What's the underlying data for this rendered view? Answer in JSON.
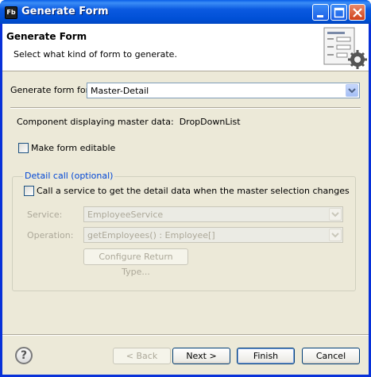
{
  "window": {
    "title": "Generate Form",
    "app_icon": "Fb"
  },
  "banner": {
    "title": "Generate Form",
    "subtitle": "Select what kind of form to generate.",
    "image": "form-gear-icon"
  },
  "form": {
    "generate_for_label": "Generate form for:",
    "generate_for_value": "Master-Detail",
    "master_label": "Component displaying master data:",
    "master_value": "DropDownList",
    "editable_label": "Make form editable",
    "editable_checked": false
  },
  "detail_call": {
    "legend": "Detail call (optional)",
    "service_checkbox_label": "Call a service to get the detail data when the master selection changes",
    "service_checkbox_checked": false,
    "service_label": "Service:",
    "service_value": "EmployeeService",
    "operation_label": "Operation:",
    "operation_value": "getEmployees() : Employee[]",
    "configure_button": "Configure Return Type..."
  },
  "footer": {
    "back": "< Back",
    "next": "Next >",
    "finish": "Finish",
    "cancel": "Cancel",
    "help_icon": "?"
  },
  "colors": {
    "title_bar": "#0054e3",
    "dialog_bg": "#ece9d8",
    "group_legend": "#0046d5"
  }
}
